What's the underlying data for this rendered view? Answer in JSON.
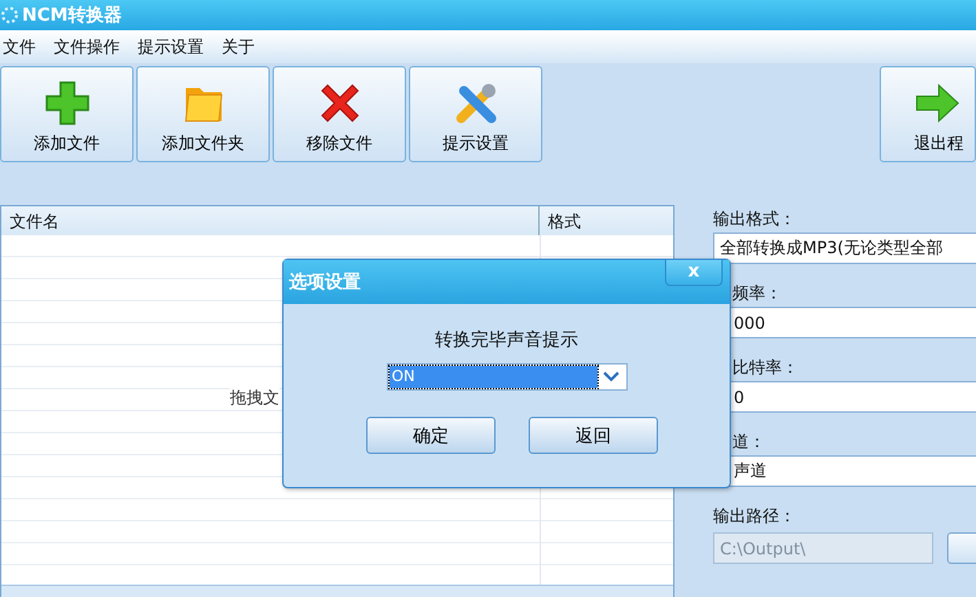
{
  "window": {
    "title": "NCM转换器"
  },
  "menu": [
    "文件",
    "文件操作",
    "提示设置",
    "关于"
  ],
  "toolbar": [
    {
      "label": "添加文件",
      "kind": "add"
    },
    {
      "label": "添加文件夹",
      "kind": "folder"
    },
    {
      "label": "移除文件",
      "kind": "remove"
    },
    {
      "label": "提示设置",
      "kind": "settings"
    }
  ],
  "exit_button": {
    "label": "退出程",
    "kind": "exit"
  },
  "file_list": {
    "columns": [
      "文件名",
      "格式"
    ],
    "hint": "拖拽文"
  },
  "settings": [
    {
      "label": "输出格式：",
      "value": "全部转换成MP3(无论类型全部",
      "hidden": false
    },
    {
      "label": "频率：",
      "value": "000",
      "hidden": true
    },
    {
      "label": "比特率：",
      "value": "0",
      "hidden": true
    },
    {
      "label": "道：",
      "value": "声道",
      "hidden": true
    }
  ],
  "output_path": {
    "label": "输出路径：",
    "value": "C:\\Output\\"
  },
  "dialog": {
    "title": "选项设置",
    "close": "x",
    "prompt": "转换完毕声音提示",
    "select_value": "ON",
    "buttons": [
      "确定",
      "返回"
    ]
  }
}
